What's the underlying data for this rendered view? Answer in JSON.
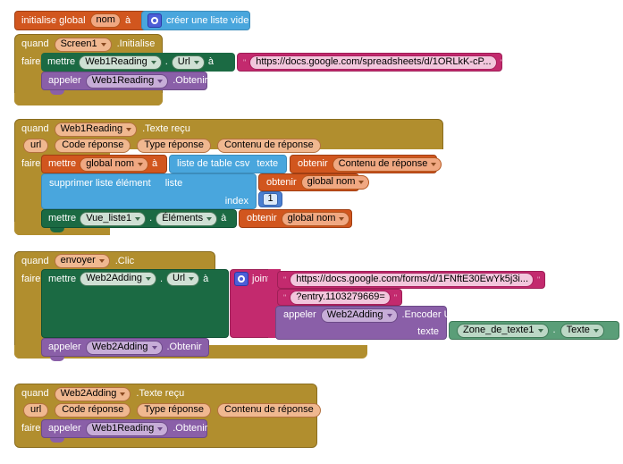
{
  "app": {
    "editor": "MIT App Inventor Blocks Editor",
    "language": "fr"
  },
  "blocks": {
    "global_init": {
      "keyword": "initialise global",
      "variable": "nom",
      "to": "à",
      "value_block": "créer une liste vide",
      "gear_icon": "gear-icon"
    },
    "screen1_init": {
      "when": "quand",
      "component": "Screen1",
      "event": ".Initialise",
      "do": "faire",
      "statements": [
        {
          "set": "mettre",
          "component": "Web1Reading",
          "dot": ".",
          "property": "Url",
          "to": "à",
          "value_quote": "\"",
          "value": "https://docs.google.com/spreadsheets/d/1ORLkK-cP..."
        },
        {
          "call": "appeler",
          "component": "Web1Reading",
          "method": ".Obtenir"
        }
      ]
    },
    "web1_text_received": {
      "when": "quand",
      "component": "Web1Reading",
      "event": ".Texte reçu",
      "params": [
        "url",
        "Code réponse",
        "Type réponse",
        "Contenu de réponse"
      ],
      "do": "faire",
      "set_global": {
        "set": "mettre",
        "variable": "global nom",
        "to": "à",
        "list_from_csv": "liste de table csv",
        "text_label": "texte",
        "get": "obtenir",
        "get_value": "Contenu de réponse"
      },
      "remove_list_item": {
        "label": "supprimer liste élément",
        "list_label": "liste",
        "get": "obtenir",
        "get_value": "global nom",
        "index_label": "index",
        "index_value": "1"
      },
      "set_listview": {
        "set": "mettre",
        "component": "Vue_liste1",
        "dot": ".",
        "property": "Éléments",
        "to": "à",
        "get": "obtenir",
        "get_value": "global nom"
      }
    },
    "envoyer_click": {
      "when": "quand",
      "component": "envoyer",
      "event": ".Clic",
      "do": "faire",
      "set_url": {
        "set": "mettre",
        "component": "Web2Adding",
        "dot": ".",
        "property": "Url",
        "to": "à"
      },
      "join": {
        "label": "joint",
        "gear_icon": "gear-icon",
        "items": [
          {
            "type": "text",
            "quote": "\"",
            "value": "https://docs.google.com/forms/d/1FNftE30EwYk5j3i..."
          },
          {
            "type": "text",
            "quote": "\"",
            "value": "?entry.1103279669="
          },
          {
            "type": "call",
            "call": "appeler",
            "component": "Web2Adding",
            "method": ".Encoder Uri",
            "arg_label": "texte",
            "arg_component": "Zone_de_texte1",
            "arg_dot": ".",
            "arg_property": "Texte"
          }
        ]
      },
      "call_obtenir": {
        "call": "appeler",
        "component": "Web2Adding",
        "method": ".Obtenir"
      }
    },
    "web2_text_received": {
      "when": "quand",
      "component": "Web2Adding",
      "event": ".Texte reçu",
      "params": [
        "url",
        "Code réponse",
        "Type réponse",
        "Contenu de réponse"
      ],
      "do": "faire",
      "call": {
        "call": "appeler",
        "component": "Web1Reading",
        "method": ".Obtenir"
      }
    }
  },
  "colors": {
    "event": "#b18e2e",
    "variable": "#d1561e",
    "list": "#49a6dd",
    "setter": "#1b6a43",
    "method": "#8a5fa8",
    "text": "#c32a6e",
    "math": "#4a7fd1"
  }
}
